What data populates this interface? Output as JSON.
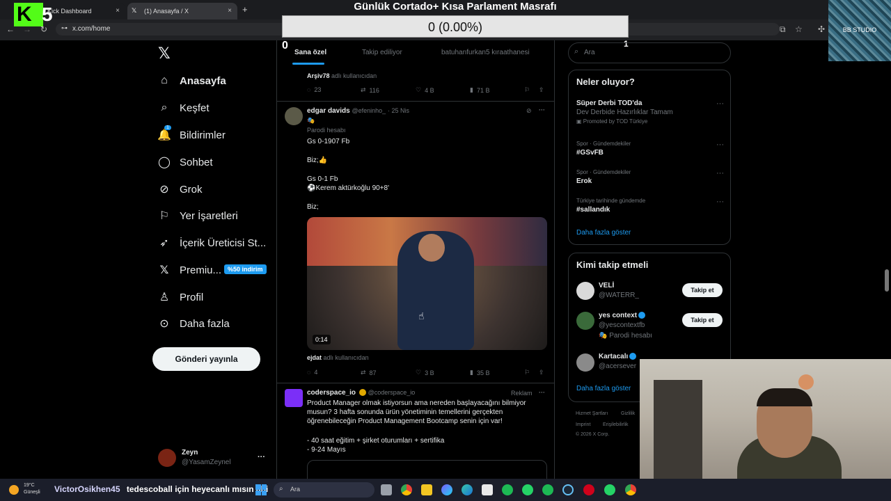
{
  "browser": {
    "tabs": [
      {
        "label": "Kick Dashboard",
        "close": "×"
      },
      {
        "label": "(1) Anasayfa / X",
        "close": "×"
      }
    ],
    "new_tab": "+",
    "address": "x.com/home"
  },
  "overlay": {
    "kick_logo": "K",
    "kick_digit": "5",
    "title": "Günlük Cortado+ Kısa Parlament Masrafı",
    "progress_text": "0 (0.00%)",
    "counter_left": "0",
    "counter_right": "1",
    "studio": "BB STUDIO"
  },
  "sidebar": {
    "items": [
      {
        "label": "Anasayfa",
        "icon": "home-icon"
      },
      {
        "label": "Keşfet",
        "icon": "search-icon"
      },
      {
        "label": "Bildirimler",
        "icon": "bell-icon",
        "badge": "1"
      },
      {
        "label": "Sohbet",
        "icon": "chat-icon"
      },
      {
        "label": "Grok",
        "icon": "grok-icon"
      },
      {
        "label": "Yer İşaretleri",
        "icon": "bookmark-icon"
      },
      {
        "label": "İçerik Üreticisi St...",
        "icon": "rocket-icon"
      },
      {
        "label": "Premiu...",
        "icon": "x-logo-icon",
        "promo": "%50 indirim"
      },
      {
        "label": "Profil",
        "icon": "person-icon"
      },
      {
        "label": "Daha fazla",
        "icon": "more-circle-icon"
      }
    ],
    "post_button": "Gönderi yayınla",
    "profile": {
      "name": "Zeyn",
      "handle": "@YasamZeynel",
      "more": "···"
    }
  },
  "feed": {
    "tabs": [
      "Sana özel",
      "Takip ediliyor",
      "batuhanfurkan5 kıraathanesi"
    ],
    "prev_post": {
      "author": "Arşiv78",
      "note": "adlı kullanıcıdan",
      "replies": "23",
      "reposts": "116",
      "likes": "4 B",
      "views": "71 B"
    },
    "post": {
      "name": "edgar davids",
      "handle": "@efeninho_",
      "date": "· 25 Nis",
      "emoji": "🎭",
      "parody": "Parodi hesabı",
      "lines": [
        "Gs 0-1907 Fb",
        "Biz;👍",
        "Gs 0-1 Fb",
        "⚽Kerem aktürkoğlu 90+8'",
        "Biz;"
      ],
      "video_duration": "0:14",
      "source_author": "ejdat",
      "source_note": "adlı kullanıcıdan",
      "replies": "4",
      "reposts": "87",
      "likes": "3 B",
      "views": "35 B"
    },
    "ad": {
      "name": "coderspace_io",
      "handle": "@coderspace_io",
      "tag": "Reklam",
      "text": "Product Manager olmak istiyorsun ama nereden başlayacağını bilmiyor musun? 3 hafta sonunda ürün yönetiminin temellerini gerçekten öğrenebileceğin Product Management Bootcamp senin için var!",
      "bullets": [
        "- 40 saat eğitim + şirket oturumları + sertifika",
        "- 9-24 Mayıs"
      ]
    }
  },
  "right": {
    "search_placeholder": "Ara",
    "trends_title": "Neler oluyor?",
    "trends": [
      {
        "title": "Süper Derbi TOD'da",
        "sub": "Dev Derbide Hazırlıklar Tamam",
        "promo": "Promoted by TOD Türkiye"
      },
      {
        "context": "Spor · Gündemdekiler",
        "title": "#GSvFB"
      },
      {
        "context": "Spor · Gündemdekiler",
        "title": "Erok"
      },
      {
        "context": "Türkiye tarihinde gündemde",
        "title": "#sallandık"
      }
    ],
    "show_more": "Daha fazla göster",
    "follow_title": "Kimi takip etmeli",
    "follow": [
      {
        "name": "VELİ",
        "handle": "@WATERR_",
        "button": "Takip et"
      },
      {
        "name": "yes context",
        "handle": "@yescontextfb",
        "note": "🎭 Parodi hesabı",
        "button": "Takip et"
      },
      {
        "name": "Kartacalı",
        "handle": "@acersever"
      }
    ],
    "follow_more": "Daha fazla göster",
    "footer": [
      "Hizmet Şartları",
      "Gizlilik",
      "Imprint",
      "Erişilebilirlik",
      "© 2026 X Corp."
    ]
  },
  "taskbar": {
    "weather_temp": "19°C",
    "weather_desc": "Güneşli",
    "ticker_user": "VictorOsikhen45",
    "ticker_msg": "tedescoball için heyecanlı mısın abi",
    "search": "Ara"
  },
  "colors": {
    "accent": "#1d9bf0",
    "kick": "#53fc18"
  }
}
